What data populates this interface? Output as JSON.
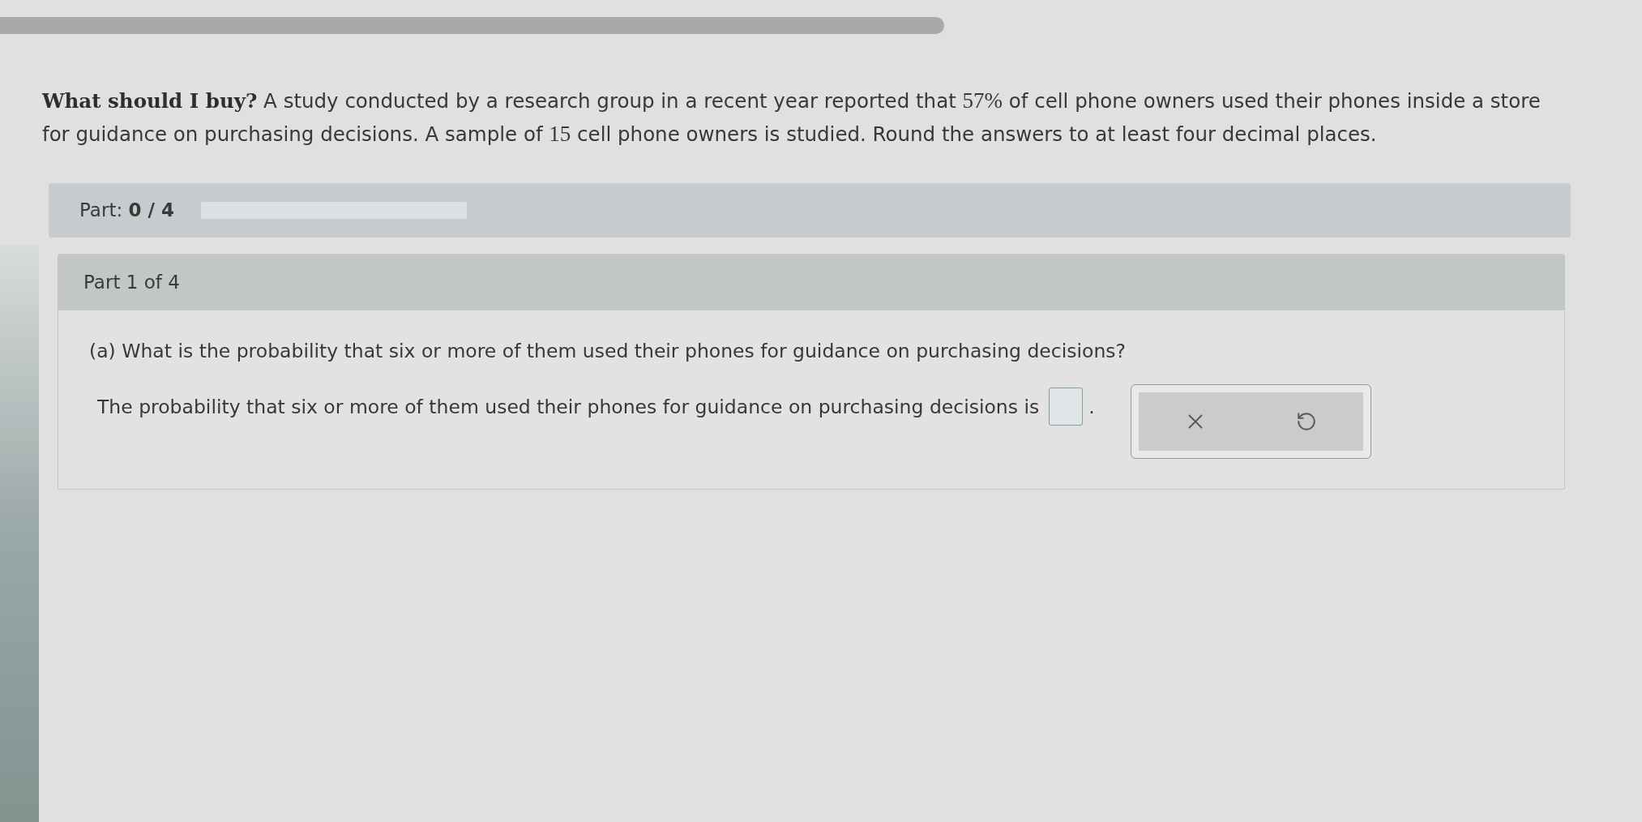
{
  "problem": {
    "segments": [
      {
        "kind": "bold",
        "text": "What should I buy?"
      },
      {
        "kind": "text",
        "text": "A study conducted by a research group in a recent year reported that"
      },
      {
        "kind": "math",
        "text": "57%"
      },
      {
        "kind": "text",
        "text": "of cell phone owners used their phones inside a store for guidance on purchasing decisions. A sample of"
      },
      {
        "kind": "math",
        "text": "15"
      },
      {
        "kind": "text",
        "text": "cell phone owners is studied. Round the answers to at least four decimal places."
      }
    ]
  },
  "part_progress": {
    "label": "Part: **0 / 4**",
    "level": 0
  },
  "part": {
    "title": "Part 1 of 4",
    "question": "(a) What is the probability that six or more of them used their phones for guidance on purchasing decisions?",
    "answer_prompt": "The probability that six or more of them used their phones for guidance on purchasing decisions is",
    "answer_suffix": ".",
    "actions": [
      {
        "kind": "clear"
      },
      {
        "kind": "undo"
      }
    ]
  }
}
